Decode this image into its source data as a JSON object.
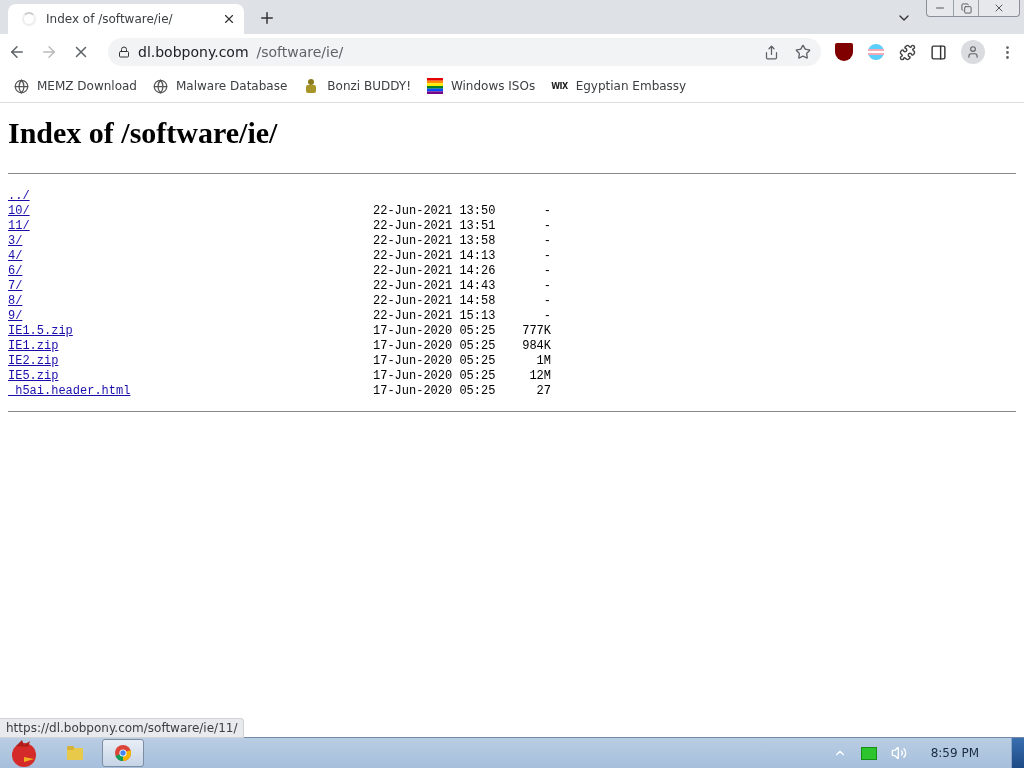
{
  "tabs": [
    {
      "title": "Index of /software/ie/",
      "selected": true
    }
  ],
  "toolbar": {
    "loading": true,
    "address": {
      "host": "dl.bobpony.com",
      "path": "/software/ie/"
    }
  },
  "bookmarks": [
    {
      "label": "MEMZ Download",
      "kind": "globe"
    },
    {
      "label": "Malware Database",
      "kind": "globe"
    },
    {
      "label": "Bonzi BUDDY!",
      "kind": "figure"
    },
    {
      "label": "Windows ISOs",
      "kind": "rainbow"
    },
    {
      "label": "Egyptian Embassy",
      "kind": "wordmark",
      "mark": "WIX"
    }
  ],
  "page": {
    "heading": "Index of /software/ie/",
    "entries": [
      {
        "name": "../"
      },
      {
        "name": "10/",
        "date": "22-Jun-2021 13:50",
        "size": "-"
      },
      {
        "name": "11/",
        "date": "22-Jun-2021 13:51",
        "size": "-"
      },
      {
        "name": "3/",
        "date": "22-Jun-2021 13:58",
        "size": "-"
      },
      {
        "name": "4/",
        "date": "22-Jun-2021 14:13",
        "size": "-"
      },
      {
        "name": "6/",
        "date": "22-Jun-2021 14:26",
        "size": "-"
      },
      {
        "name": "7/",
        "date": "22-Jun-2021 14:43",
        "size": "-"
      },
      {
        "name": "8/",
        "date": "22-Jun-2021 14:58",
        "size": "-"
      },
      {
        "name": "9/",
        "date": "22-Jun-2021 15:13",
        "size": "-"
      },
      {
        "name": "IE1.5.zip",
        "date": "17-Jun-2020 05:25",
        "size": "777K"
      },
      {
        "name": "IE1.zip",
        "date": "17-Jun-2020 05:25",
        "size": "984K"
      },
      {
        "name": "IE2.zip",
        "date": "17-Jun-2020 05:25",
        "size": "1M"
      },
      {
        "name": "IE5.zip",
        "date": "17-Jun-2020 05:25",
        "size": "12M"
      },
      {
        "name": "_h5ai.header.html",
        "date": "17-Jun-2020 05:25",
        "size": "27"
      }
    ]
  },
  "status_bubble": "https://dl.bobpony.com/software/ie/11/",
  "taskbar": {
    "clock": "8:59 PM",
    "apps": [
      {
        "kind": "folder",
        "selected": false
      },
      {
        "kind": "browser",
        "selected": true
      }
    ]
  }
}
